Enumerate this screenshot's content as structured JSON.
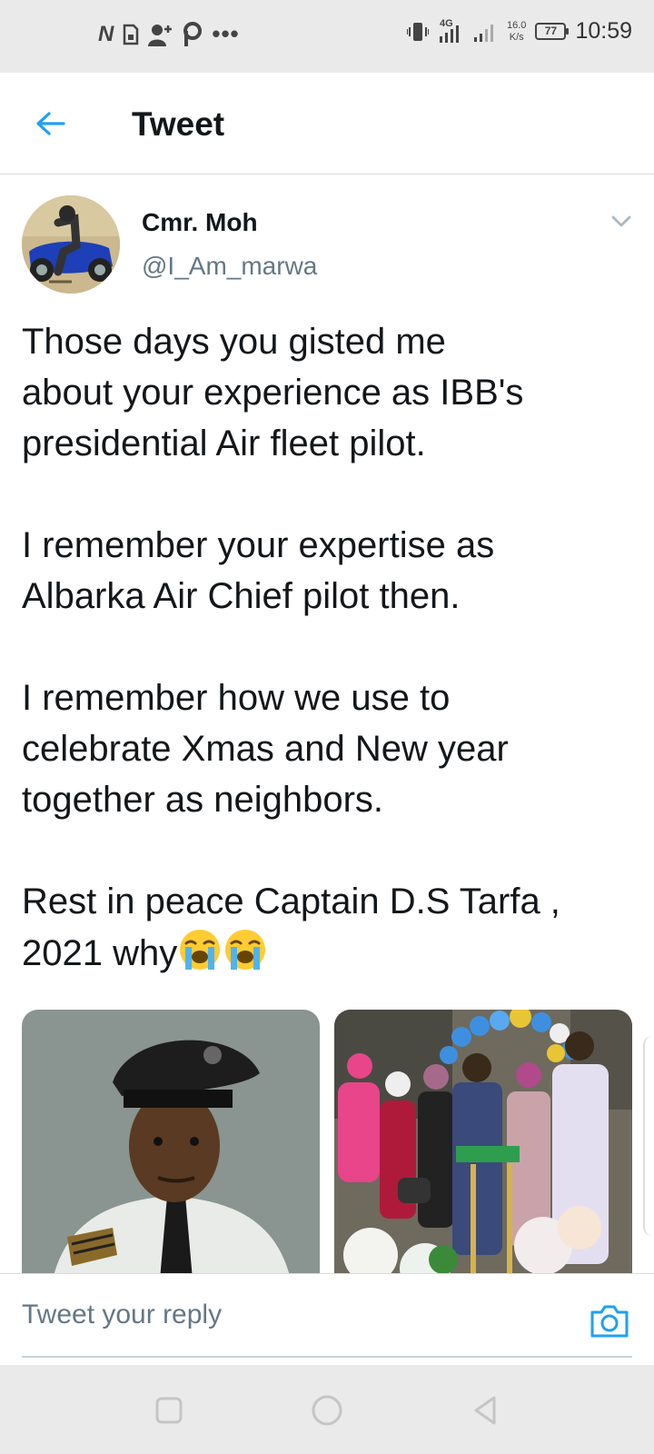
{
  "status_bar": {
    "time": "10:59",
    "net_speed_value": "16.0",
    "net_speed_unit": "K/s",
    "network_type": "4G",
    "battery_level": "77",
    "left_icons": [
      "n-app-icon",
      "sim-icon",
      "add-person-icon",
      "p-app-icon"
    ],
    "more_dots": "•••"
  },
  "header": {
    "title": "Tweet",
    "accent_color": "#1da1f2"
  },
  "tweet": {
    "author_name": "Cmr. Moh",
    "author_handle": "@I_Am_marwa",
    "paragraphs": [
      [
        "Those days you gisted me",
        "about your experience as IBB's",
        "presidential Air fleet pilot."
      ],
      [
        "I remember your expertise as",
        "Albarka Air Chief pilot then."
      ],
      [
        "I remember how we use to",
        "celebrate Xmas and New year",
        "together as neighbors."
      ],
      [
        "Rest in peace Captain D.S Tarfa ,",
        "2021 why"
      ]
    ],
    "emojis": [
      "loudly-crying-face-emoji",
      "loudly-crying-face-emoji"
    ]
  },
  "reply": {
    "placeholder": "Tweet your reply"
  },
  "nav": {
    "buttons": [
      "recent-apps",
      "home",
      "back"
    ]
  }
}
